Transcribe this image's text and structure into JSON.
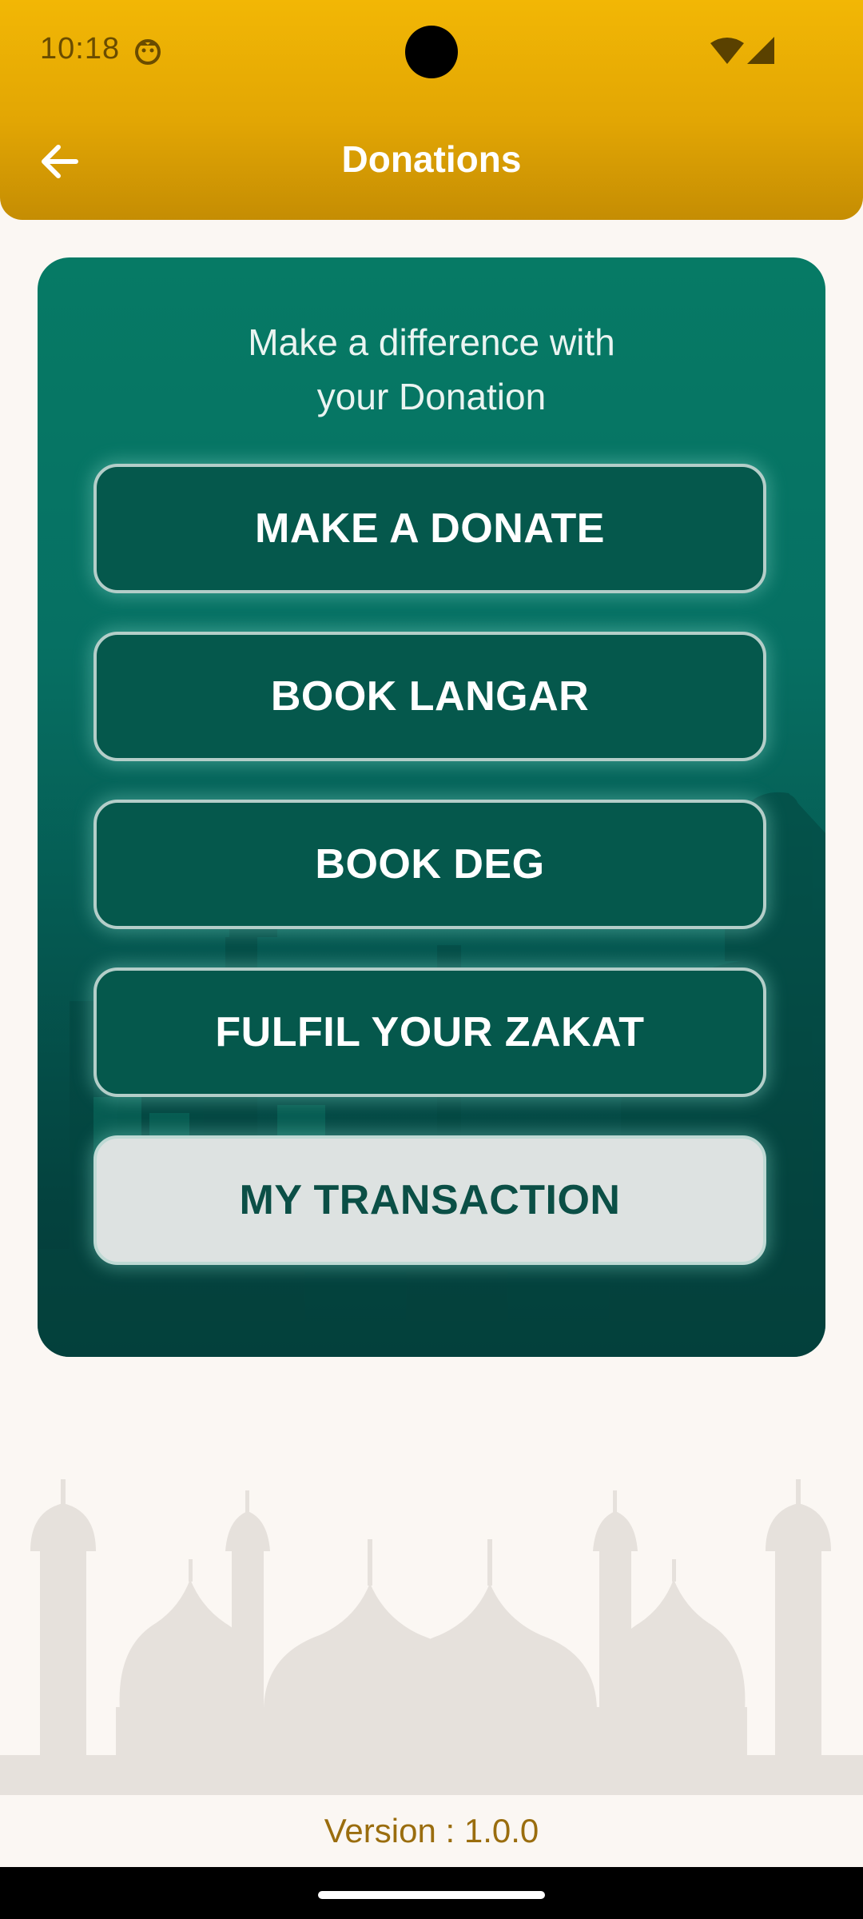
{
  "status_bar": {
    "time": "10:18"
  },
  "header": {
    "title": "Donations",
    "back_icon": "arrow-left-icon"
  },
  "card": {
    "text_line1": "Make a difference with",
    "text_line2": "your Donation"
  },
  "buttons": [
    {
      "label": "MAKE A DONATE"
    },
    {
      "label": "BOOK LANGAR"
    },
    {
      "label": "BOOK DEG"
    },
    {
      "label": "FULFIL YOUR ZAKAT"
    },
    {
      "label": "MY TRANSACTION"
    }
  ],
  "footer": {
    "version": "Version : 1.0.0"
  },
  "colors": {
    "header_gold": "#f2b705",
    "card_green": "#067a65",
    "button_green": "#05584c",
    "button_light": "#dde2e1",
    "footer_text": "#9a6d0e"
  }
}
